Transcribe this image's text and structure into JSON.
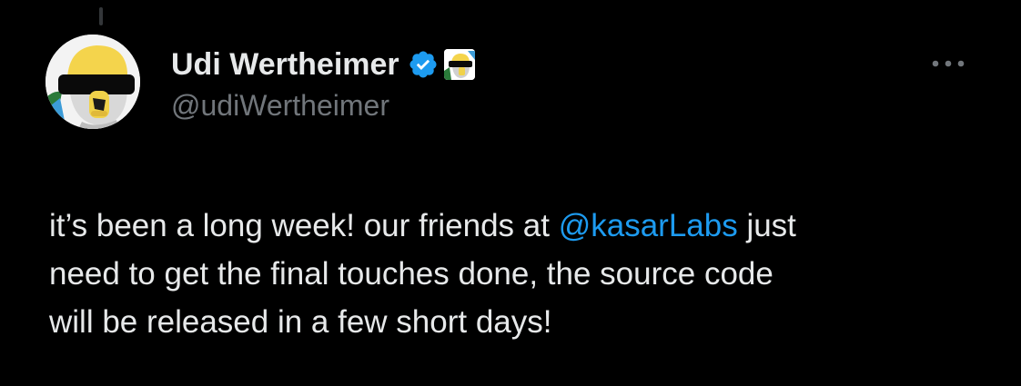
{
  "author": {
    "display_name": "Udi Wertheimer",
    "handle": "@udiWertheimer",
    "verified": true
  },
  "tweet": {
    "line1_before": "it’s been a long week! our friends at ",
    "mention": "@kasarLabs",
    "line1_after": " just",
    "line2": "need to get the final touches done, the source code",
    "line3": "will be released in a few short days!"
  },
  "icons": {
    "verified": "verified-badge-icon",
    "affiliate": "affiliate-avatar-icon",
    "more": "more-options-icon"
  },
  "colors": {
    "background": "#000000",
    "primary_text": "#e7e9ea",
    "secondary_text": "#71767b",
    "accent": "#1d9bf0"
  }
}
